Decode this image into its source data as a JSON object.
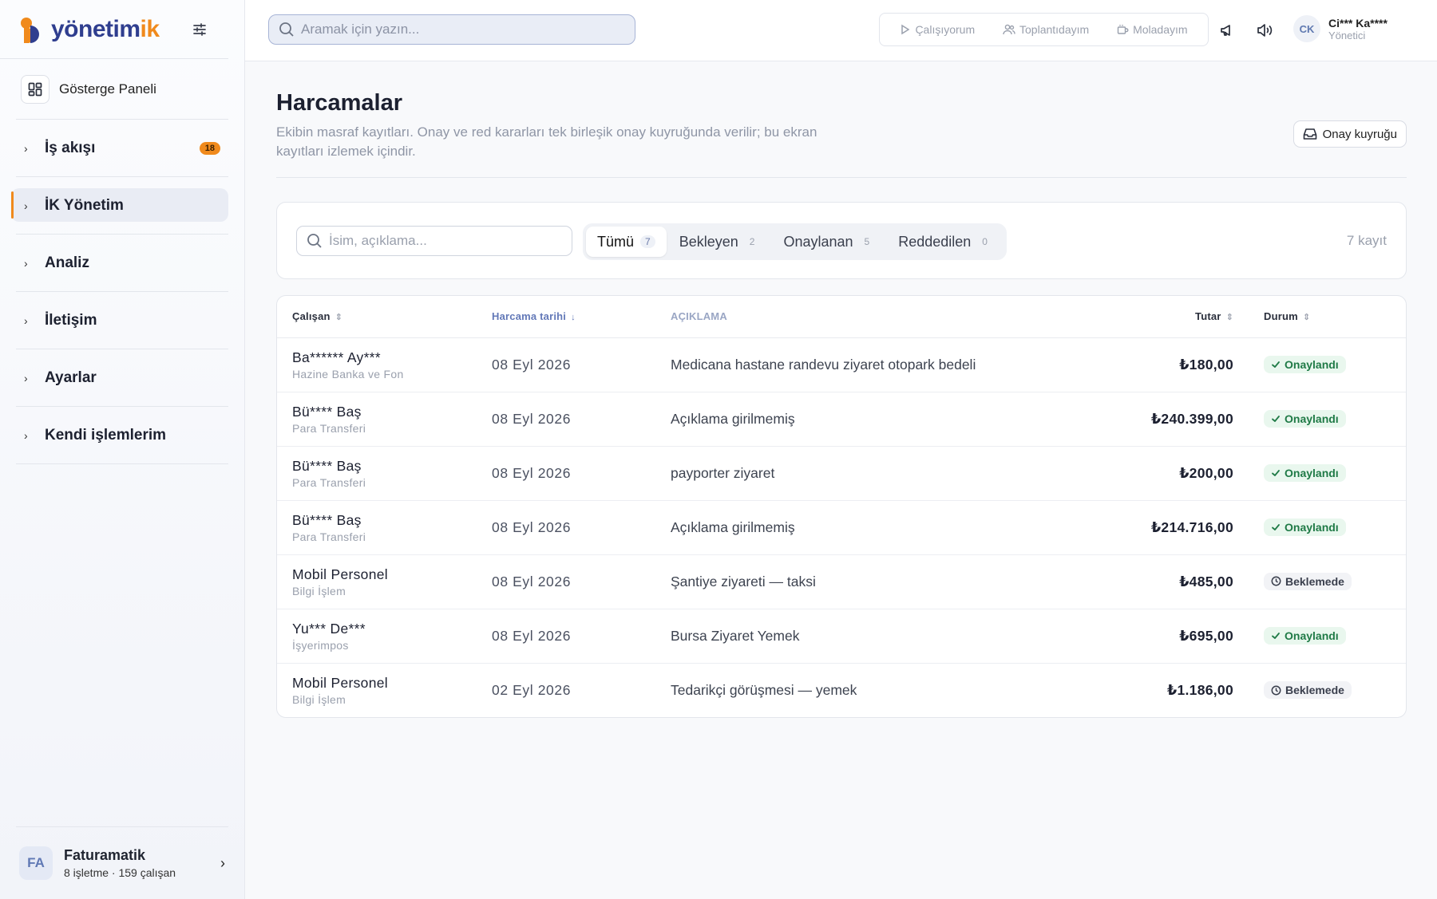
{
  "brand": {
    "name_main": "yönetim",
    "name_accent": "ik",
    "accent_color": "#f08a1c",
    "primary_color": "#2f3e8f"
  },
  "sidebar": {
    "dashboard_label": "Gösterge Paneli",
    "items": [
      {
        "label": "İş akışı",
        "badge": "18"
      },
      {
        "label": "İK Yönetim"
      },
      {
        "label": "Analiz"
      },
      {
        "label": "İletişim"
      },
      {
        "label": "Ayarlar"
      },
      {
        "label": "Kendi işlemlerim"
      }
    ],
    "org": {
      "initials": "FA",
      "name": "Faturamatik",
      "sub": "8 işletme · 159 çalışan"
    }
  },
  "topbar": {
    "search_placeholder": "Aramak için yazın...",
    "statuses": [
      "Çalışıyorum",
      "Toplantıdayım",
      "Moladayım"
    ],
    "user": {
      "initials": "CK",
      "name": "Ci*** Ka****",
      "role": "Yönetici"
    }
  },
  "page": {
    "title": "Harcamalar",
    "description": "Ekibin masraf kayıtları. Onay ve red kararları tek birleşik onay kuyruğunda verilir; bu ekran kayıtları izlemek içindir.",
    "queue_button": "Onay kuyruğu"
  },
  "filter": {
    "search_placeholder": "İsim, açıklama...",
    "tabs": [
      {
        "label": "Tümü",
        "count": "7"
      },
      {
        "label": "Bekleyen",
        "count": "2"
      },
      {
        "label": "Onaylanan",
        "count": "5"
      },
      {
        "label": "Reddedilen",
        "count": "0"
      }
    ],
    "record_count": "7 kayıt"
  },
  "table": {
    "headers": {
      "employee": "Çalışan",
      "date": "Harcama tarihi",
      "description": "AÇIKLAMA",
      "amount": "Tutar",
      "status": "Durum"
    },
    "rows": [
      {
        "name": "Ba****** Ay***",
        "dept": "Hazine Banka ve Fon",
        "date": "08 Eyl 2026",
        "desc": "Medicana hastane randevu ziyaret otopark bedeli",
        "amount": "₺180,00",
        "status": "Onaylandı",
        "type": "ok"
      },
      {
        "name": "Bü**** Baş",
        "dept": "Para Transferi",
        "date": "08 Eyl 2026",
        "desc": "Açıklama girilmemiş",
        "amount": "₺240.399,00",
        "status": "Onaylandı",
        "type": "ok"
      },
      {
        "name": "Bü**** Baş",
        "dept": "Para Transferi",
        "date": "08 Eyl 2026",
        "desc": "payporter ziyaret",
        "amount": "₺200,00",
        "status": "Onaylandı",
        "type": "ok"
      },
      {
        "name": "Bü**** Baş",
        "dept": "Para Transferi",
        "date": "08 Eyl 2026",
        "desc": "Açıklama girilmemiş",
        "amount": "₺214.716,00",
        "status": "Onaylandı",
        "type": "ok"
      },
      {
        "name": "Mobil Personel",
        "dept": "Bilgi İşlem",
        "date": "08 Eyl 2026",
        "desc": "Şantiye ziyareti — taksi",
        "amount": "₺485,00",
        "status": "Beklemede",
        "type": "wait"
      },
      {
        "name": "Yu*** De***",
        "dept": "İşyerimpos",
        "date": "08 Eyl 2026",
        "desc": "Bursa Ziyaret Yemek",
        "amount": "₺695,00",
        "status": "Onaylandı",
        "type": "ok"
      },
      {
        "name": "Mobil Personel",
        "dept": "Bilgi İşlem",
        "date": "02 Eyl 2026",
        "desc": "Tedarikçi görüşmesi — yemek",
        "amount": "₺1.186,00",
        "status": "Beklemede",
        "type": "wait"
      }
    ]
  }
}
